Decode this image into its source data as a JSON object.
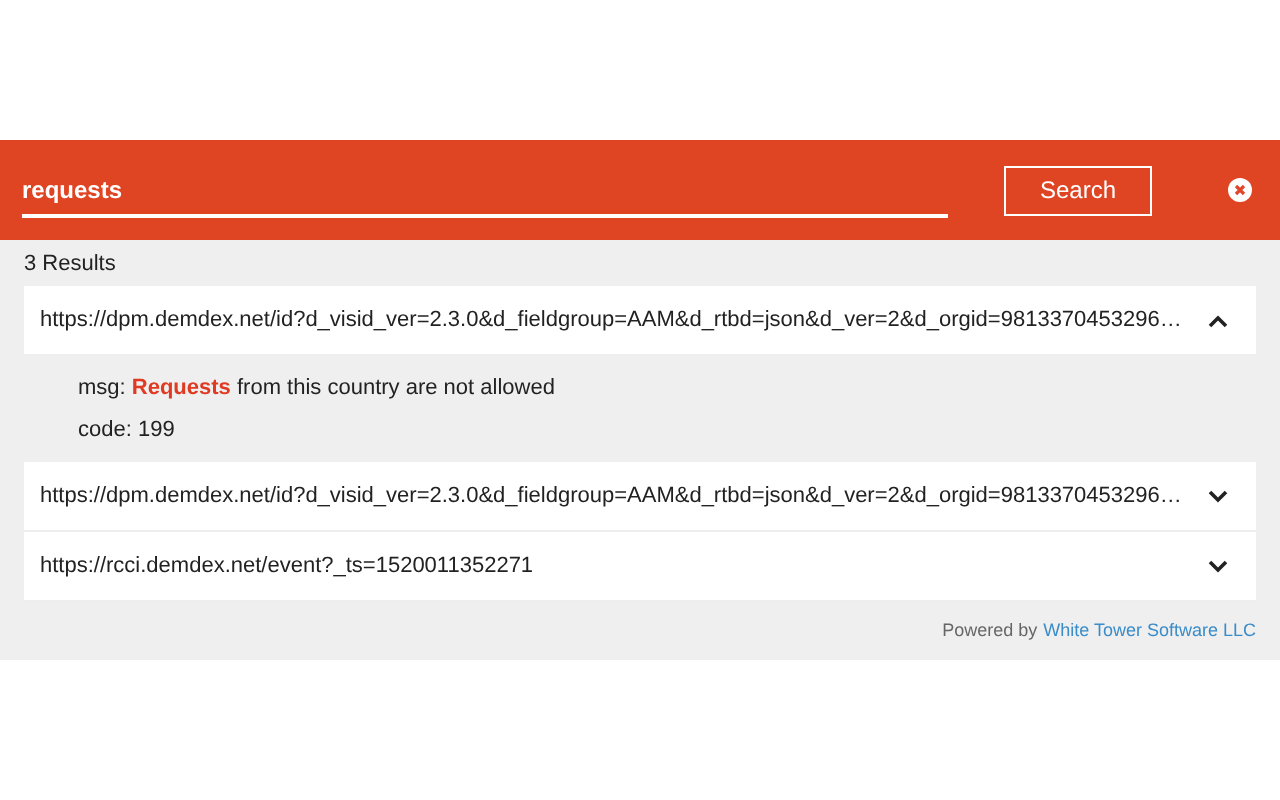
{
  "search": {
    "value": "requests",
    "button": "Search"
  },
  "results_count": "3 Results",
  "results": [
    {
      "url": "https://dpm.demdex.net/id?d_visid_ver=2.3.0&d_fieldgroup=AAM&d_rtbd=json&d_ver=2&d_orgid=9813370453296…",
      "expanded": true,
      "details": [
        "msg: **Requests** from this country are not allowed",
        "code: 199"
      ]
    },
    {
      "url": "https://dpm.demdex.net/id?d_visid_ver=2.3.0&d_fieldgroup=AAM&d_rtbd=json&d_ver=2&d_orgid=9813370453296…",
      "expanded": false
    },
    {
      "url": "https://rcci.demdex.net/event?_ts=1520011352271",
      "expanded": false
    }
  ],
  "footer": {
    "prefix": "Powered by",
    "link": "White Tower Software LLC"
  }
}
